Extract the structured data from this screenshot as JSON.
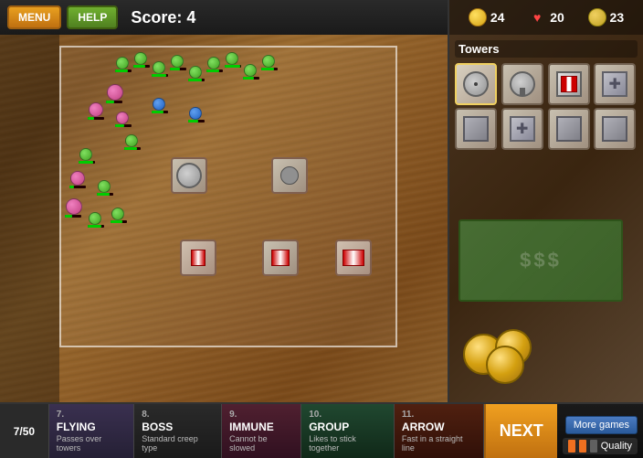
{
  "header": {
    "menu_label": "MENU",
    "help_label": "HELP",
    "score_label": "Score:",
    "score_value": "4"
  },
  "resources": {
    "gold_icon": "gold",
    "gold_value": "24",
    "heart_icon": "♥",
    "heart_value": "20",
    "coin_icon": "coin",
    "coin_value": "23"
  },
  "towers_panel": {
    "title": "Towers",
    "slots": [
      {
        "id": 1,
        "type": "radar",
        "active": true
      },
      {
        "id": 2,
        "type": "radar2",
        "active": false
      },
      {
        "id": 3,
        "type": "flag",
        "active": false
      },
      {
        "id": 4,
        "type": "cross",
        "active": false
      },
      {
        "id": 5,
        "type": "empty",
        "active": false
      },
      {
        "id": 6,
        "type": "cross2",
        "active": false
      },
      {
        "id": 7,
        "type": "empty2",
        "active": false
      },
      {
        "id": 8,
        "type": "empty3",
        "active": false
      }
    ]
  },
  "wave_counter": {
    "current": "7",
    "total": "50",
    "display": "7/50"
  },
  "wave_cards": [
    {
      "number": "7.",
      "name": "FLYING",
      "description": "Passes over towers",
      "color_class": "card-flying"
    },
    {
      "number": "8.",
      "name": "BOSS",
      "description": "Standard creep type",
      "color_class": "card-boss"
    },
    {
      "number": "9.",
      "name": "IMMUNE",
      "description": "Cannot be slowed",
      "color_class": "card-immune"
    },
    {
      "number": "10.",
      "name": "GROUP",
      "description": "Likes to stick together",
      "color_class": "card-group"
    },
    {
      "number": "11.",
      "name": "ARROW",
      "description": "Fast in a straight line",
      "color_class": "card-arrow"
    }
  ],
  "next_button": {
    "label": "NEXT"
  },
  "bottom_right": {
    "more_games_label": "More games",
    "quality_label": "Quality"
  }
}
